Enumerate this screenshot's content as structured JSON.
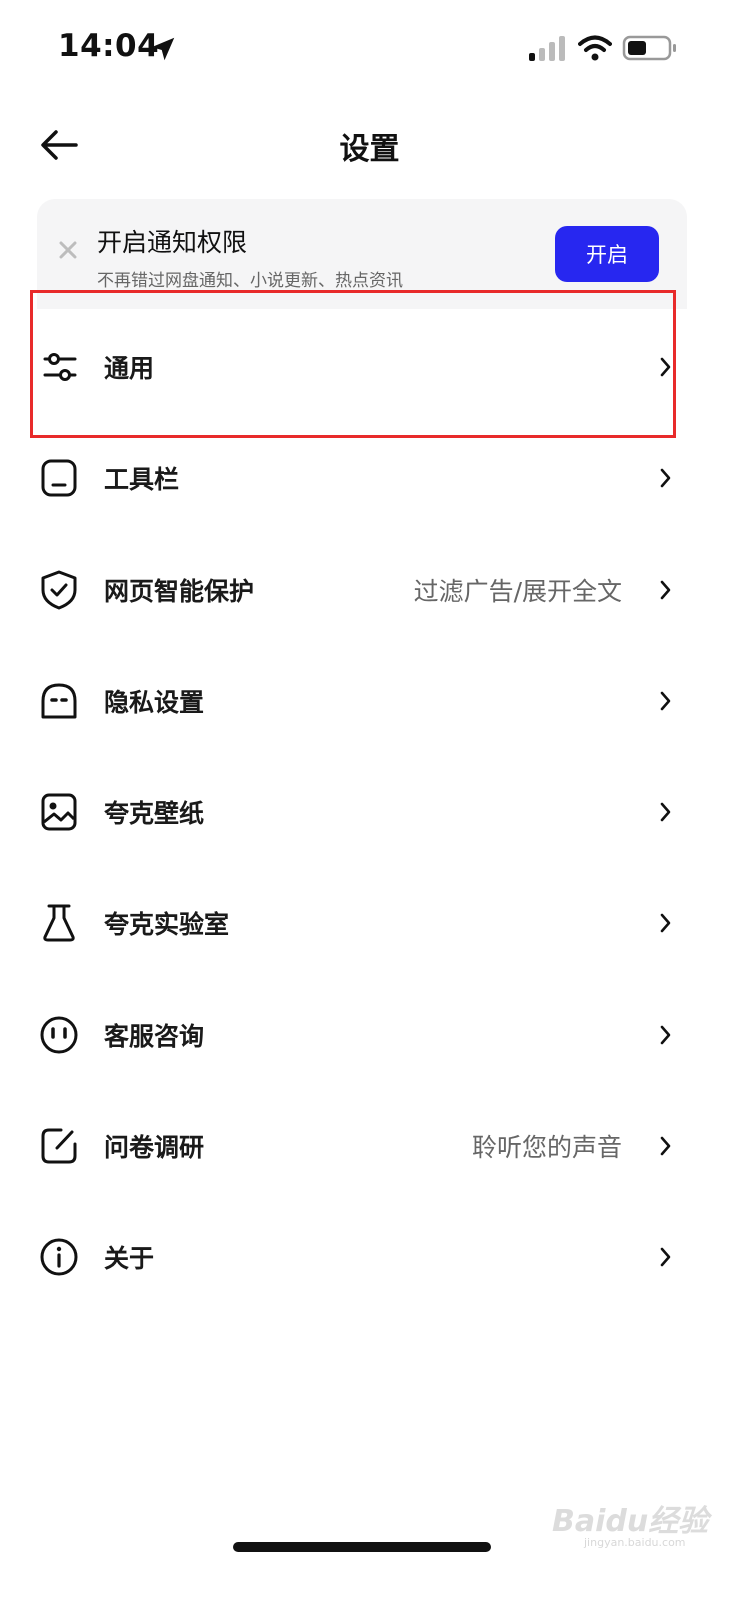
{
  "status_bar": {
    "time": "14:04"
  },
  "header": {
    "title": "设置"
  },
  "notification_banner": {
    "title": "开启通知权限",
    "subtitle": "不再错过网盘通知、小说更新、热点资讯",
    "button_label": "开启"
  },
  "menu": {
    "items": [
      {
        "label": "通用",
        "value": "",
        "icon": "sliders-icon"
      },
      {
        "label": "工具栏",
        "value": "",
        "icon": "toolbar-icon"
      },
      {
        "label": "网页智能保护",
        "value": "过滤广告/展开全文",
        "icon": "shield-check-icon"
      },
      {
        "label": "隐私设置",
        "value": "",
        "icon": "privacy-mask-icon"
      },
      {
        "label": "夸克壁纸",
        "value": "",
        "icon": "image-icon"
      },
      {
        "label": "夸克实验室",
        "value": "",
        "icon": "flask-icon"
      },
      {
        "label": "客服咨询",
        "value": "",
        "icon": "service-face-icon"
      },
      {
        "label": "问卷调研",
        "value": "聆听您的声音",
        "icon": "edit-icon"
      },
      {
        "label": "关于",
        "value": "",
        "icon": "info-icon"
      }
    ]
  },
  "watermark": {
    "brand": "Baidu经验",
    "url": "jingyan.baidu.com"
  },
  "colors": {
    "accent": "#2727f0",
    "highlight_box": "#e82a2a",
    "banner_bg": "#f5f5f6"
  }
}
